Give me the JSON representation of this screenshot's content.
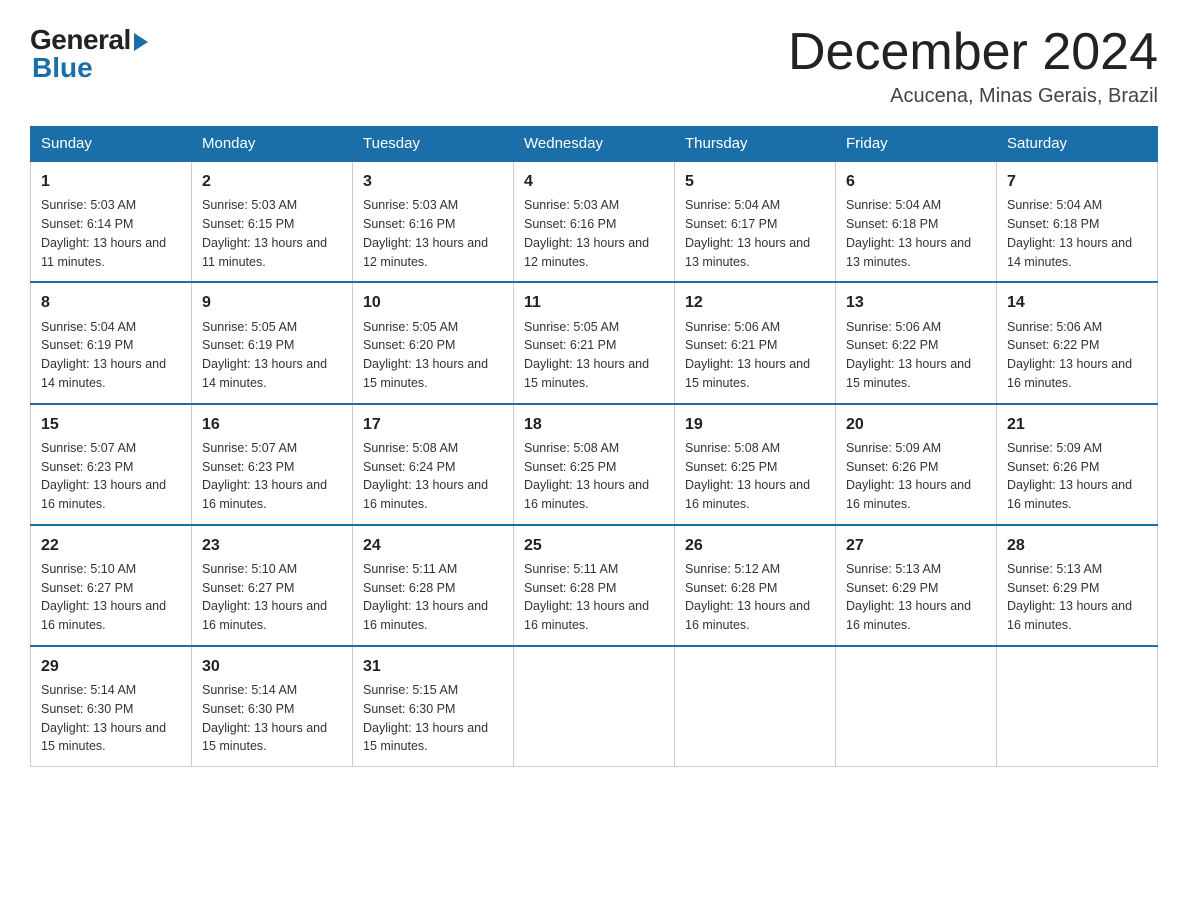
{
  "logo": {
    "general": "General",
    "blue": "Blue"
  },
  "title": "December 2024",
  "location": "Acucena, Minas Gerais, Brazil",
  "days_of_week": [
    "Sunday",
    "Monday",
    "Tuesday",
    "Wednesday",
    "Thursday",
    "Friday",
    "Saturday"
  ],
  "weeks": [
    [
      {
        "day": "1",
        "sunrise": "5:03 AM",
        "sunset": "6:14 PM",
        "daylight": "13 hours and 11 minutes."
      },
      {
        "day": "2",
        "sunrise": "5:03 AM",
        "sunset": "6:15 PM",
        "daylight": "13 hours and 11 minutes."
      },
      {
        "day": "3",
        "sunrise": "5:03 AM",
        "sunset": "6:16 PM",
        "daylight": "13 hours and 12 minutes."
      },
      {
        "day": "4",
        "sunrise": "5:03 AM",
        "sunset": "6:16 PM",
        "daylight": "13 hours and 12 minutes."
      },
      {
        "day": "5",
        "sunrise": "5:04 AM",
        "sunset": "6:17 PM",
        "daylight": "13 hours and 13 minutes."
      },
      {
        "day": "6",
        "sunrise": "5:04 AM",
        "sunset": "6:18 PM",
        "daylight": "13 hours and 13 minutes."
      },
      {
        "day": "7",
        "sunrise": "5:04 AM",
        "sunset": "6:18 PM",
        "daylight": "13 hours and 14 minutes."
      }
    ],
    [
      {
        "day": "8",
        "sunrise": "5:04 AM",
        "sunset": "6:19 PM",
        "daylight": "13 hours and 14 minutes."
      },
      {
        "day": "9",
        "sunrise": "5:05 AM",
        "sunset": "6:19 PM",
        "daylight": "13 hours and 14 minutes."
      },
      {
        "day": "10",
        "sunrise": "5:05 AM",
        "sunset": "6:20 PM",
        "daylight": "13 hours and 15 minutes."
      },
      {
        "day": "11",
        "sunrise": "5:05 AM",
        "sunset": "6:21 PM",
        "daylight": "13 hours and 15 minutes."
      },
      {
        "day": "12",
        "sunrise": "5:06 AM",
        "sunset": "6:21 PM",
        "daylight": "13 hours and 15 minutes."
      },
      {
        "day": "13",
        "sunrise": "5:06 AM",
        "sunset": "6:22 PM",
        "daylight": "13 hours and 15 minutes."
      },
      {
        "day": "14",
        "sunrise": "5:06 AM",
        "sunset": "6:22 PM",
        "daylight": "13 hours and 16 minutes."
      }
    ],
    [
      {
        "day": "15",
        "sunrise": "5:07 AM",
        "sunset": "6:23 PM",
        "daylight": "13 hours and 16 minutes."
      },
      {
        "day": "16",
        "sunrise": "5:07 AM",
        "sunset": "6:23 PM",
        "daylight": "13 hours and 16 minutes."
      },
      {
        "day": "17",
        "sunrise": "5:08 AM",
        "sunset": "6:24 PM",
        "daylight": "13 hours and 16 minutes."
      },
      {
        "day": "18",
        "sunrise": "5:08 AM",
        "sunset": "6:25 PM",
        "daylight": "13 hours and 16 minutes."
      },
      {
        "day": "19",
        "sunrise": "5:08 AM",
        "sunset": "6:25 PM",
        "daylight": "13 hours and 16 minutes."
      },
      {
        "day": "20",
        "sunrise": "5:09 AM",
        "sunset": "6:26 PM",
        "daylight": "13 hours and 16 minutes."
      },
      {
        "day": "21",
        "sunrise": "5:09 AM",
        "sunset": "6:26 PM",
        "daylight": "13 hours and 16 minutes."
      }
    ],
    [
      {
        "day": "22",
        "sunrise": "5:10 AM",
        "sunset": "6:27 PM",
        "daylight": "13 hours and 16 minutes."
      },
      {
        "day": "23",
        "sunrise": "5:10 AM",
        "sunset": "6:27 PM",
        "daylight": "13 hours and 16 minutes."
      },
      {
        "day": "24",
        "sunrise": "5:11 AM",
        "sunset": "6:28 PM",
        "daylight": "13 hours and 16 minutes."
      },
      {
        "day": "25",
        "sunrise": "5:11 AM",
        "sunset": "6:28 PM",
        "daylight": "13 hours and 16 minutes."
      },
      {
        "day": "26",
        "sunrise": "5:12 AM",
        "sunset": "6:28 PM",
        "daylight": "13 hours and 16 minutes."
      },
      {
        "day": "27",
        "sunrise": "5:13 AM",
        "sunset": "6:29 PM",
        "daylight": "13 hours and 16 minutes."
      },
      {
        "day": "28",
        "sunrise": "5:13 AM",
        "sunset": "6:29 PM",
        "daylight": "13 hours and 16 minutes."
      }
    ],
    [
      {
        "day": "29",
        "sunrise": "5:14 AM",
        "sunset": "6:30 PM",
        "daylight": "13 hours and 15 minutes."
      },
      {
        "day": "30",
        "sunrise": "5:14 AM",
        "sunset": "6:30 PM",
        "daylight": "13 hours and 15 minutes."
      },
      {
        "day": "31",
        "sunrise": "5:15 AM",
        "sunset": "6:30 PM",
        "daylight": "13 hours and 15 minutes."
      },
      null,
      null,
      null,
      null
    ]
  ]
}
